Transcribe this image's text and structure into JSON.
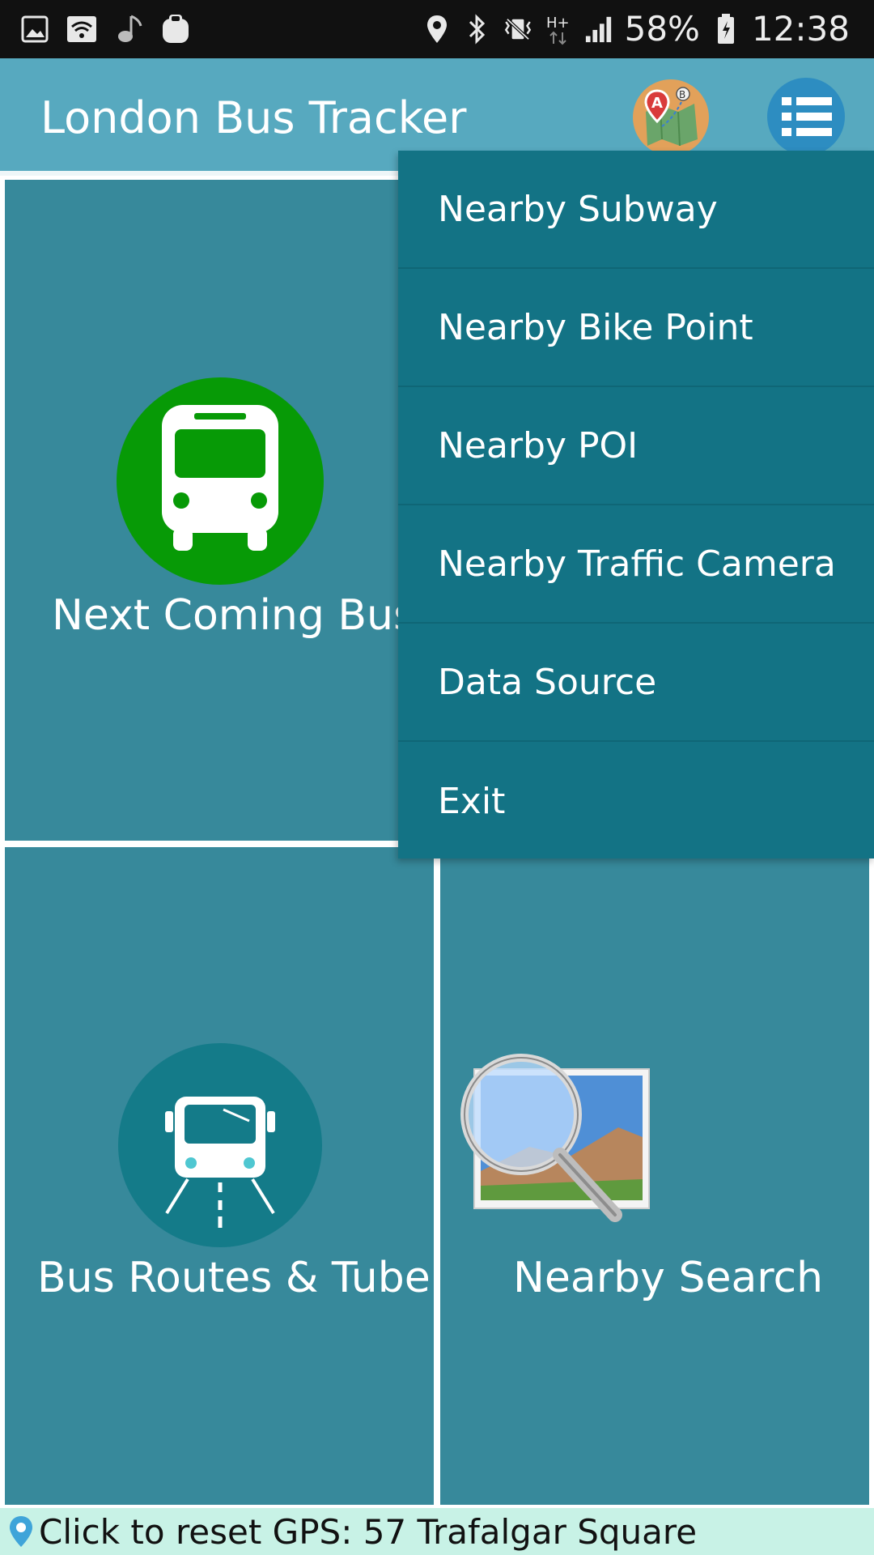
{
  "status_bar": {
    "left_icons": [
      "gallery-icon",
      "wifi-icon",
      "music-icon",
      "galaxy-app-icon"
    ],
    "right_icons": [
      "location-icon",
      "bluetooth-icon",
      "vibrate-mute-icon",
      "data-hplus-icon",
      "signal-icon"
    ],
    "battery_percent": "58%",
    "time": "12:38"
  },
  "app_bar": {
    "title": "London Bus Tracker",
    "map_button_icon": "route-map-icon",
    "menu_button_icon": "list-menu-icon"
  },
  "tiles": {
    "next_bus": {
      "label": "Next Coming Bus",
      "icon": "bus-icon"
    },
    "routes": {
      "label": "Bus Routes & Tube",
      "icon": "bus-road-icon"
    },
    "search": {
      "label": "Nearby Search",
      "icon": "magnifier-photo-icon"
    }
  },
  "menu": {
    "items": [
      {
        "label": "Nearby Subway"
      },
      {
        "label": "Nearby Bike Point"
      },
      {
        "label": "Nearby POI"
      },
      {
        "label": "Nearby Traffic Camera"
      },
      {
        "label": "Data Source"
      },
      {
        "label": "Exit"
      }
    ]
  },
  "gps": {
    "text": "Click to reset GPS: 57 Trafalgar Square",
    "icon": "map-pin-icon"
  },
  "colors": {
    "app_bar": "#57a9bf",
    "tile": "#37899b",
    "menu": "#137385",
    "bus_circle": "#079a06",
    "gps_bar": "#c8f2e6"
  }
}
